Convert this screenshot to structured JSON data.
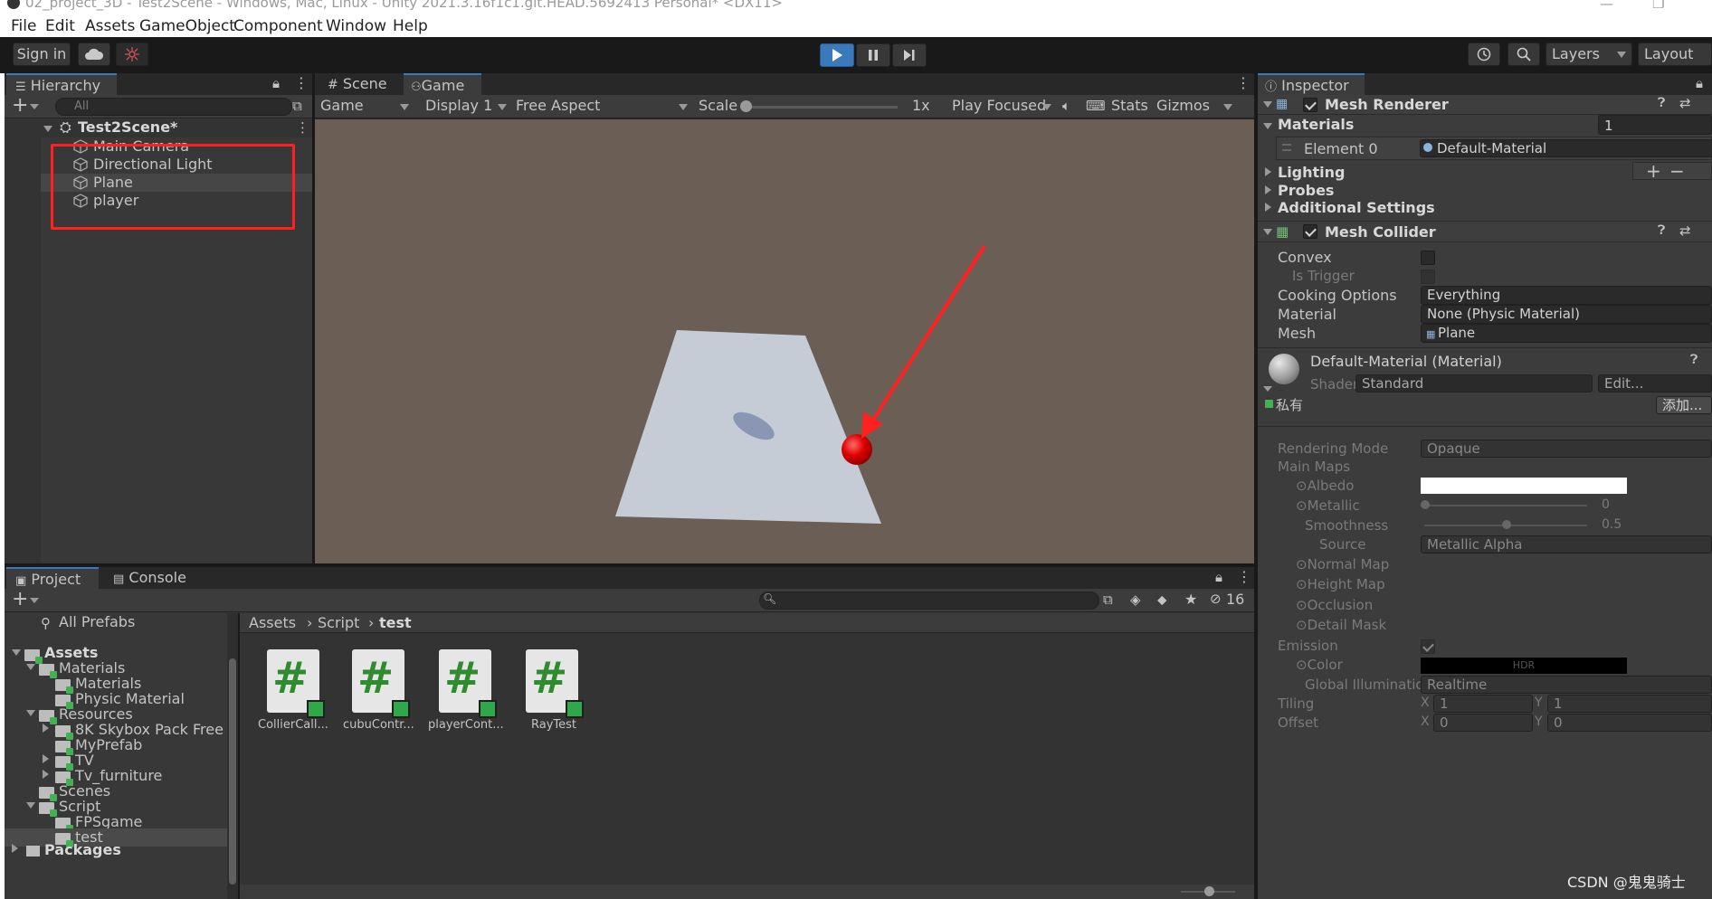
{
  "window": {
    "title": "02_project_3D - Test2Scene - Windows, Mac, Linux - Unity 2021.3.16f1c1.git.HEAD.5692413 Personal* <DX11>",
    "min": "—",
    "max": "❐",
    "close": "✕"
  },
  "menu": [
    "File",
    "Edit",
    "Assets",
    "GameObject",
    "Component",
    "Window",
    "Help"
  ],
  "toolbar": {
    "signin": "Sign in",
    "layers": "Layers",
    "layout": "Layout"
  },
  "hierarchy": {
    "tab": "Hierarchy",
    "search_placeholder": "All",
    "scene": "Test2Scene*",
    "items": [
      "Main Camera",
      "Directional Light",
      "Plane",
      "player"
    ]
  },
  "game": {
    "tabs": [
      "Scene",
      "Game"
    ],
    "game_dropdown": "Game",
    "display": "Display 1",
    "aspect": "Free Aspect",
    "scale_label": "Scale",
    "scale_value": "1x",
    "play_focused": "Play Focused",
    "stats": "Stats",
    "gizmos": "Gizmos"
  },
  "project": {
    "tabs": [
      "Project",
      "Console"
    ],
    "badge_count": "16",
    "breadcrumb": [
      "Assets",
      "Script",
      "test"
    ],
    "tree": [
      {
        "label": "All Prefabs",
        "level": 0
      },
      {
        "label": "Assets",
        "level": 0
      },
      {
        "label": "Materials",
        "level": 1
      },
      {
        "label": "Materials",
        "level": 2
      },
      {
        "label": "Physic Material",
        "level": 2
      },
      {
        "label": "Resources",
        "level": 1
      },
      {
        "label": "8K Skybox Pack Free",
        "level": 2
      },
      {
        "label": "MyPrefab",
        "level": 2
      },
      {
        "label": "TV",
        "level": 2
      },
      {
        "label": "Tv_furniture",
        "level": 2
      },
      {
        "label": "Scenes",
        "level": 1
      },
      {
        "label": "Script",
        "level": 1
      },
      {
        "label": "FPSgame",
        "level": 2
      },
      {
        "label": "test",
        "level": 2
      },
      {
        "label": "Packages",
        "level": 0
      }
    ],
    "files": [
      "CollierCall...",
      "cubuContr...",
      "playerCont...",
      "RayTest"
    ]
  },
  "inspector": {
    "tab": "Inspector",
    "mesh_renderer": "Mesh Renderer",
    "materials_label": "Materials",
    "materials_count": "1",
    "element0": "Element 0",
    "element0_value": "Default-Material",
    "lighting": "Lighting",
    "probes": "Probes",
    "additional": "Additional Settings",
    "mesh_collider": "Mesh Collider",
    "convex": "Convex",
    "is_trigger": "Is Trigger",
    "cooking_options": "Cooking Options",
    "cooking_value": "Everything",
    "material": "Material",
    "material_value": "None (Physic Material)",
    "mesh": "Mesh",
    "mesh_value": "Plane",
    "mat_name": "Default-Material (Material)",
    "shader_label": "Shader",
    "shader_value": "Standard",
    "edit": "Edit...",
    "private": "私有",
    "add": "添加...",
    "rendering_mode": "Rendering Mode",
    "rendering_value": "Opaque",
    "main_maps": "Main Maps",
    "albedo": "Albedo",
    "metallic": "Metallic",
    "metallic_value": "0",
    "smoothness": "Smoothness",
    "smoothness_value": "0.5",
    "source": "Source",
    "source_value": "Metallic Alpha",
    "normal_map": "Normal Map",
    "height_map": "Height Map",
    "occlusion": "Occlusion",
    "detail_mask": "Detail Mask",
    "emission": "Emission",
    "color": "Color",
    "hdr": "HDR",
    "gi": "Global Illumination",
    "gi_value": "Realtime",
    "tiling": "Tiling",
    "offset": "Offset",
    "x": "X",
    "y": "Y",
    "tiling_x": "1",
    "tiling_y": "1",
    "offset_x": "0",
    "offset_y": "0"
  },
  "watermark": "CSDN @鬼鬼骑士",
  "colors": {
    "accent": "#3a79bb",
    "annotation": "#ff2020"
  }
}
